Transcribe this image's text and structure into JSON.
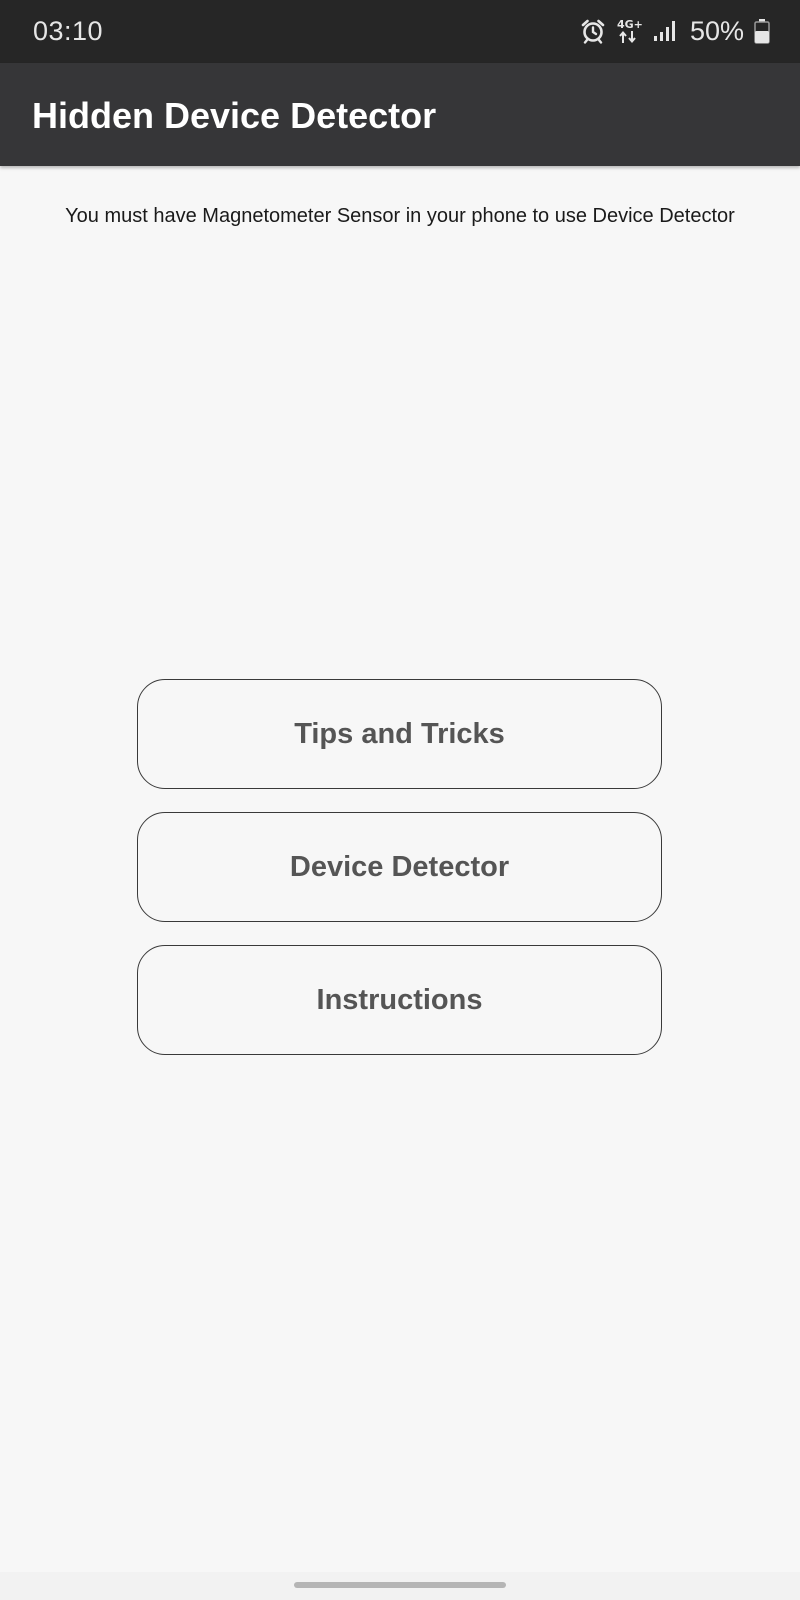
{
  "status_bar": {
    "time": "03:10",
    "network_label": "4G+",
    "battery": "50%",
    "icons": [
      "alarm-icon",
      "network-4g-icon",
      "signal-icon",
      "battery-icon"
    ]
  },
  "app_bar": {
    "title": "Hidden Device Detector"
  },
  "main": {
    "notice": "You must have Magnetometer Sensor in your phone to use Device Detector",
    "buttons": [
      {
        "label": "Tips and Tricks"
      },
      {
        "label": "Device Detector"
      },
      {
        "label": "Instructions"
      }
    ]
  },
  "colors": {
    "status_bar_bg": "#262626",
    "app_bar_bg": "#363638",
    "page_bg": "#f7f7f7",
    "button_text": "#555555",
    "button_border": "#3a3a3a"
  }
}
